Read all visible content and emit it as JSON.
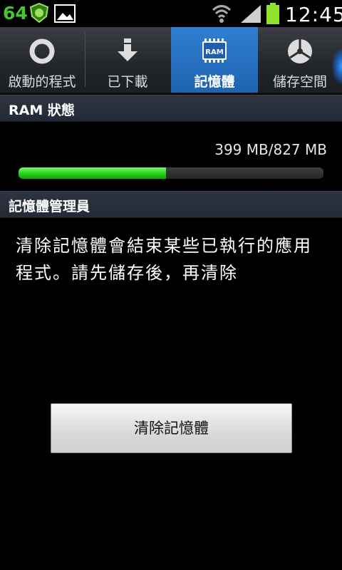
{
  "status_bar": {
    "notification_number": "64",
    "time": "12:45",
    "icons": [
      "shield-app-icon",
      "gallery-icon",
      "wifi-icon",
      "signal-icon",
      "battery-icon"
    ],
    "colors": {
      "notification_number": "#45c630",
      "battery": "#8ee22a"
    }
  },
  "tabs": [
    {
      "label": "啟動的程式",
      "icon": "running-apps-icon",
      "active": false
    },
    {
      "label": "已下載",
      "icon": "download-icon",
      "active": false
    },
    {
      "label": "記憶體",
      "icon": "ram-icon",
      "icon_text": "RAM",
      "active": true
    },
    {
      "label": "儲存空間",
      "icon": "storage-pie-icon",
      "active": false
    }
  ],
  "ram_section": {
    "header": "RAM 狀態",
    "usage_text": "399 MB/827 MB",
    "used_fraction": 0.4825
  },
  "manager_section": {
    "header": "記憶體管理員",
    "description": "清除記憶體會結束某些已執行的應用程式。請先儲存後，再清除"
  },
  "clear_button": {
    "label": "清除記憶體"
  },
  "colors": {
    "accent": "#1f63b0",
    "bar_fill": "#28d01c"
  }
}
